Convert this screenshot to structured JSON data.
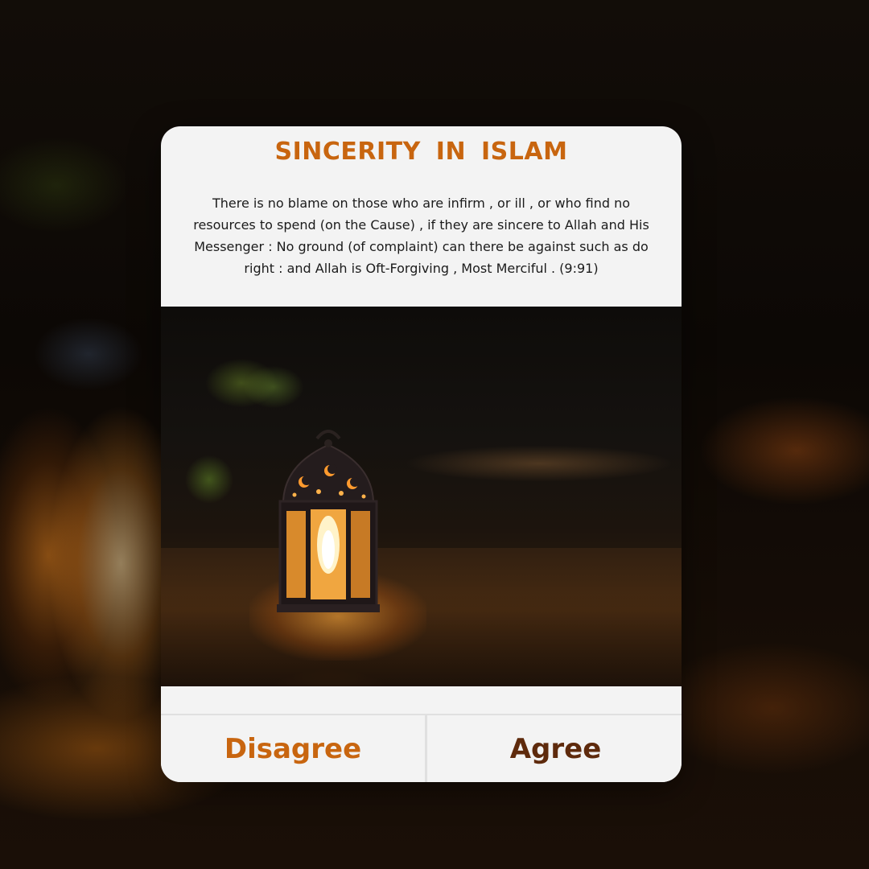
{
  "card": {
    "title": "SINCERITY IN ISLAM",
    "quote": "There is no blame on those who are infirm , or ill , or who find no resources to spend (on the Cause) , if they are sincere to Allah and His Messenger : No ground (of complaint) can there be against such as do right : and Allah is Oft-Forgiving , Most Merciful . (9:91)",
    "image": "lantern-photo"
  },
  "actions": {
    "disagree_label": "Disagree",
    "agree_label": "Agree"
  },
  "colors": {
    "accent": "#c8650f",
    "agree": "#5e2a0c",
    "card_bg": "#f3f3f3"
  }
}
